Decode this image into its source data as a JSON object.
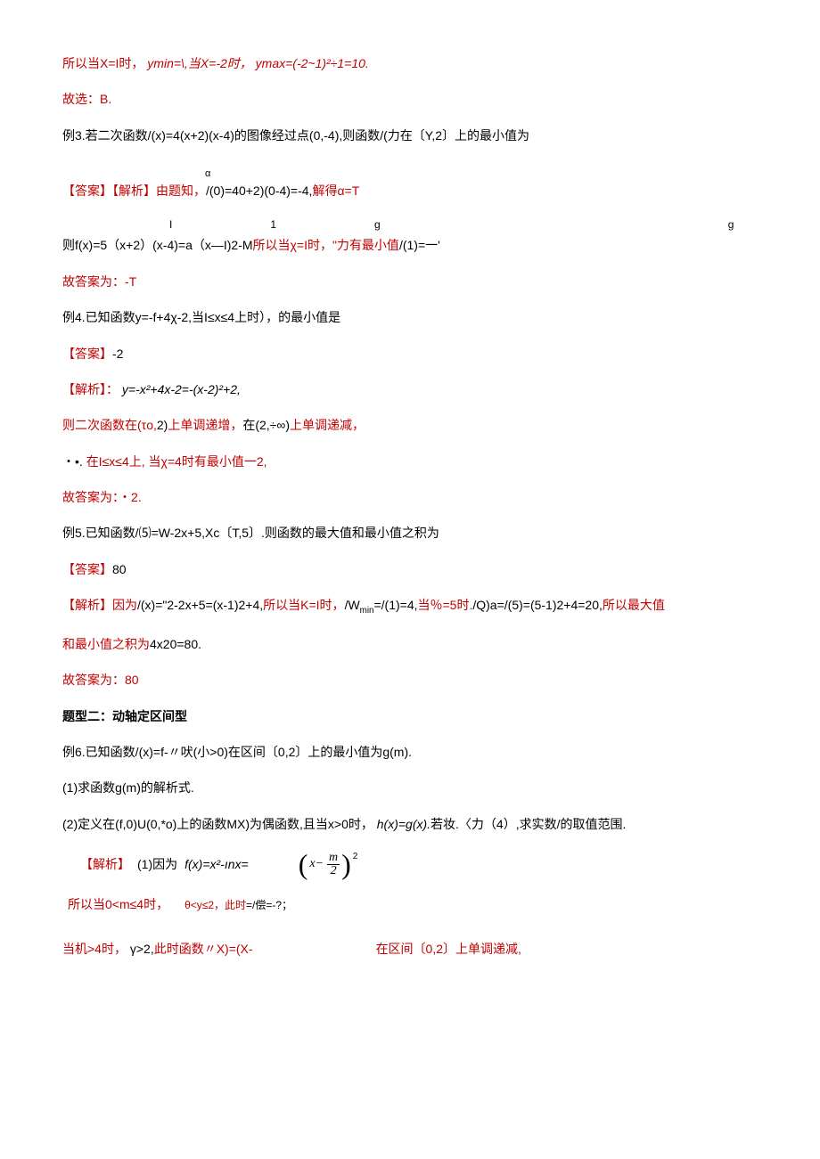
{
  "lines": {
    "l1_a": "所以当X=I时，",
    "l1_b": "ymin=\\,当X=-2时，",
    "l1_c": "ymax=(-2~1)²÷1=10.",
    "l2": "故选：B.",
    "l3": "例3.若二次函数/(x)=4(x+2)(x-4)的图像经过点(0,-4),则函数/(力在〔Y,2〕上的最小值为",
    "l4_suffix_a": "α",
    "l4_a": "【答案】【解析】",
    "l4_b": "由题知，",
    "l4_c": "/(0)=40+2)(0-4)=-4,",
    "l4_d": "解得α=T",
    "l5_sup_a": "I",
    "l5_sup_b": "1",
    "l5_sup_c": "g",
    "l5_sup_d": "g",
    "l5_a": "则f(x)=5（x+2）(x-4)=a（x—I)2-M",
    "l5_b": "所以当χ=I时，\"力",
    "l5_c": "有最小值",
    "l5_d": "/(1)=一'",
    "l6": "故答案为：-T",
    "l7": "例4.已知函数y=-f+4χ-2,当I≤x≤4上时），的最小值是",
    "l8_a": "【答案】",
    "l8_b": "-2",
    "l9_a": "【解析】：",
    "l9_b": "y=-x²+4x-2=-(x-2)²+2,",
    "l10_a": "则二次函数在(τo,",
    "l10_b": "2)",
    "l10_c": "上单调递增，",
    "l10_d": "在(2,÷∞)",
    "l10_e": "上单调递减，",
    "l11_a": "・•.",
    "l11_b": "在I≤x≤4上,",
    "l11_c": "当χ=4",
    "l11_d": "时有最小值一2,",
    "l12": "故答案为：・2.",
    "l13": "例5.已知函数/⑸=W-2x+5,Xc〔T,5〕.则函数的最大值和最小值之积为",
    "l14_a": "【答案】",
    "l14_b": "80",
    "l15_a": "【解析】",
    "l15_b": "因为",
    "l15_c": "/(x)=\"2-2x+5=(x-1)2+4,",
    "l15_d": "所以当K=I时，",
    "l15_e": "/W",
    "l15_sub": "min",
    "l15_f": "=/(1)=4,",
    "l15_g": "当％=5时.",
    "l15_h": "/Q)a=/(5)=(5-1)2+4=20,",
    "l15_i": "所以最大值",
    "l16_a": "和最小值之积为",
    "l16_b": "4x20=80.",
    "l17": "故答案为：80",
    "l18": "题型二：动轴定区间型",
    "l19": "例6.已知函数/(x)=f-〃吠(小>0)在区间〔0,2〕上的最小值为g(m).",
    "l20": "(1)求函数g(m)的解析式.",
    "l21_a": "(2)定义在(f,0)U(0,*o)上的函数MX)为偶函数,且当x>0时，",
    "l21_b": "h(x)=g(x).",
    "l21_c": "若妆.〈力（4）,求实数/的取值范围.",
    "l22_a": "【解析】",
    "l22_b": "(1)因为",
    "l22_c": "f(x)=x²-ınx=",
    "frac_num": "m",
    "frac_x": "x−",
    "frac_den": "2",
    "frac_sup": "2",
    "l23_a": "所以当0<m≤4时，",
    "l23_b": "θ<y≤2，此时",
    "l23_c": "=/偿=-?；",
    "l24_a": "当机>4时，",
    "l24_b": "γ>2,",
    "l24_c": "此时函数〃X)=(X-",
    "l24_d": "在区间〔0,2〕上单调递减,"
  }
}
